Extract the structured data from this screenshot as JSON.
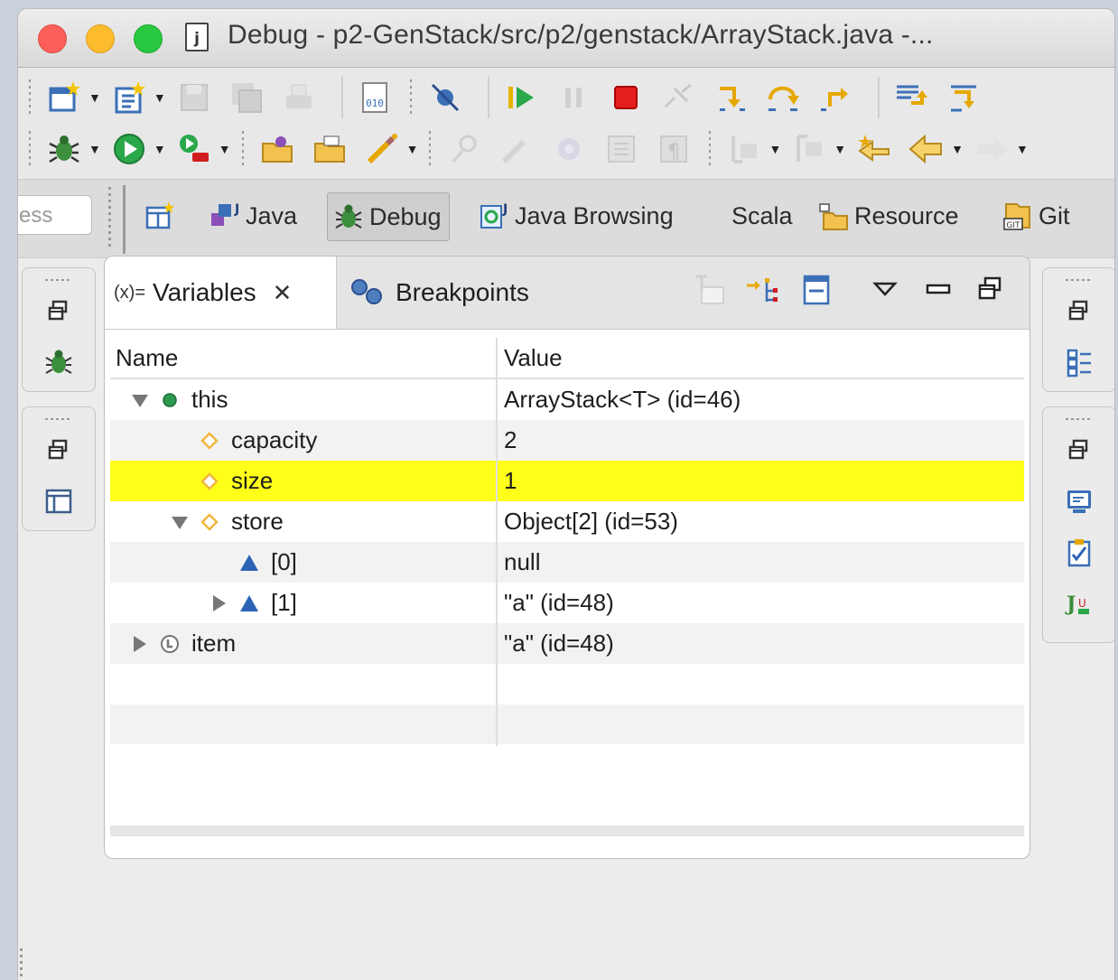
{
  "window": {
    "title": "Debug - p2-GenStack/src/p2/genstack/ArrayStack.java -...",
    "title_icon_letter": "j"
  },
  "quick_access": {
    "value": "ess"
  },
  "perspectives": [
    {
      "label": "Java",
      "icon": "java-perspective-icon"
    },
    {
      "label": "Debug",
      "icon": "bug-icon",
      "active": true
    },
    {
      "label": "Java Browsing",
      "icon": "java-browsing-icon"
    },
    {
      "label": "Scala",
      "icon": ""
    },
    {
      "label": "Resource",
      "icon": "resource-icon"
    },
    {
      "label": "Git",
      "icon": "git-icon"
    }
  ],
  "views": {
    "variables_tab": {
      "icon_text": "(x)=",
      "label": "Variables"
    },
    "breakpoints_tab": {
      "label": "Breakpoints"
    }
  },
  "variables": {
    "columns": {
      "name": "Name",
      "value": "Value"
    },
    "rows": [
      {
        "name": "this",
        "value": "ArrayStack<T>  (id=46)",
        "icon": "object-dot-icon",
        "expand": "expanded"
      },
      {
        "name": "capacity",
        "value": "2",
        "icon": "field-diamond-icon",
        "expand": "none"
      },
      {
        "name": "size",
        "value": "1",
        "icon": "field-diamond-icon",
        "expand": "none",
        "selected": true
      },
      {
        "name": "store",
        "value": "Object[2]  (id=53)",
        "icon": "field-diamond-icon",
        "expand": "expanded"
      },
      {
        "name": "[0]",
        "value": "null",
        "icon": "array-element-icon",
        "expand": "none"
      },
      {
        "name": "[1]",
        "value": "\"a\" (id=48)",
        "icon": "array-element-icon",
        "expand": "collapsed"
      },
      {
        "name": "item",
        "value": "\"a\" (id=48)",
        "icon": "local-variable-icon",
        "expand": "collapsed"
      }
    ]
  },
  "colors": {
    "selection_highlight": "#ffff19",
    "close_button": "#fc5f57",
    "minimize_button": "#fdbc2e",
    "maximize_button": "#28c840",
    "field_icon": "#f1b640",
    "object_icon": "#2e9a4f",
    "array_icon": "#2b62b6"
  }
}
